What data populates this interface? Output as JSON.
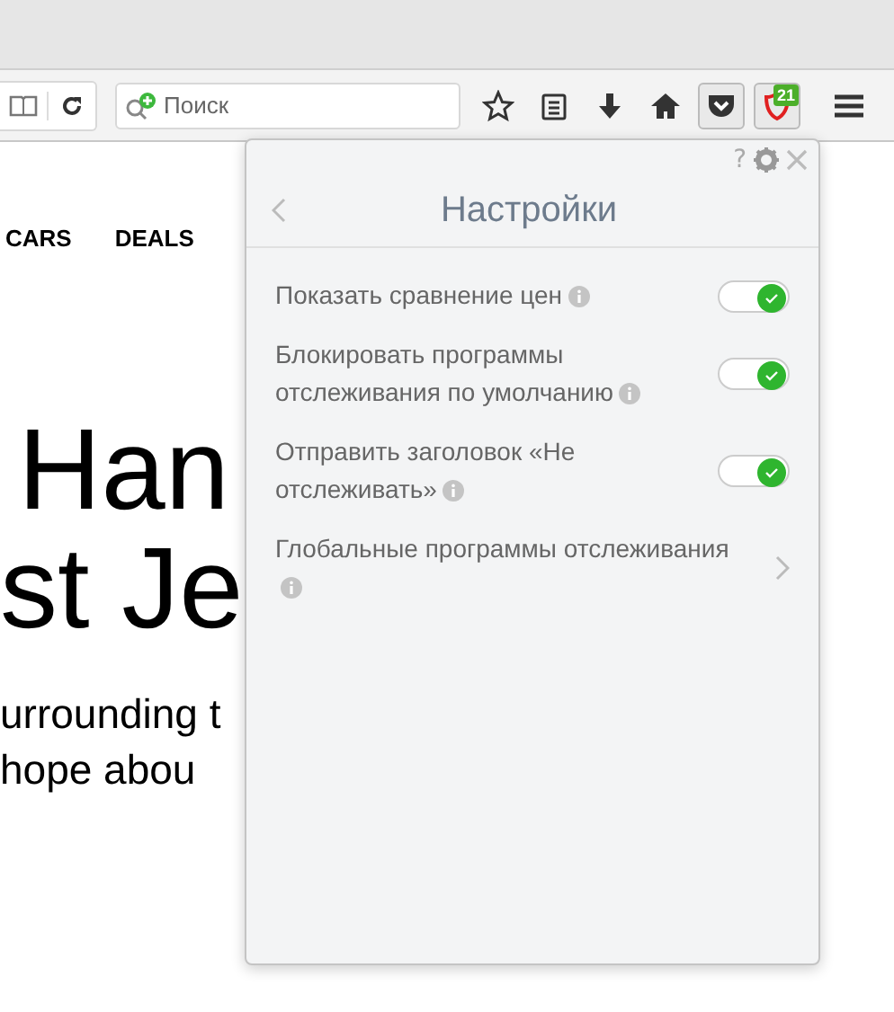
{
  "toolbar": {
    "search": {
      "placeholder": "Поиск"
    },
    "extension_badge": "21"
  },
  "page": {
    "nav": [
      "CARS",
      "DEALS"
    ],
    "headline": [
      "Han",
      "st Je"
    ],
    "body": [
      "urrounding t",
      "hope abou"
    ]
  },
  "popup": {
    "help": "?",
    "title": "Настройки",
    "items": [
      {
        "kind": "toggle",
        "label": "Показать сравнение цен",
        "on": true
      },
      {
        "kind": "toggle",
        "label": "Блокировать программы отслеживания по умолчанию",
        "on": true
      },
      {
        "kind": "toggle",
        "label": "Отправить заголовок «Не отслеживать»",
        "on": true
      },
      {
        "kind": "link",
        "label": "Глобальные программы отслеживания"
      }
    ]
  }
}
